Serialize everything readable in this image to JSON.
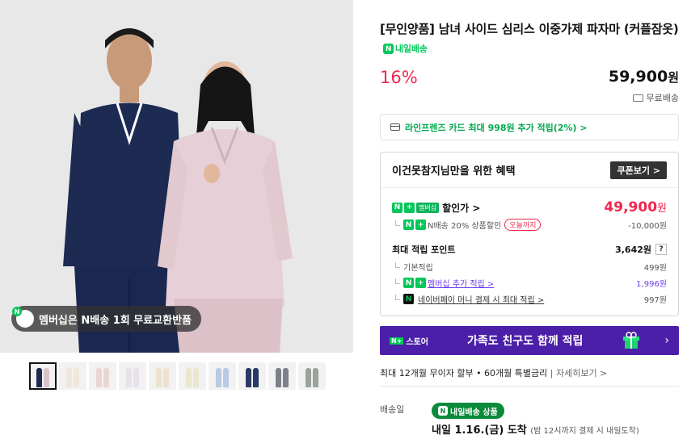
{
  "gallery": {
    "badge_text": "멤버십은 N배송 1회 무료교환반품",
    "badge_icon": "n-delivery-icon",
    "thumbnails": [
      {
        "colors": [
          "#1c2a4e",
          "#d9c4cc"
        ],
        "selected": true
      },
      {
        "colors": [
          "#efe7da",
          "#efe7da"
        ],
        "selected": false
      },
      {
        "colors": [
          "#e9d6d3",
          "#e9d6d3"
        ],
        "selected": false
      },
      {
        "colors": [
          "#e6e1ea",
          "#e6e1ea"
        ],
        "selected": false
      },
      {
        "colors": [
          "#ede3cc",
          "#ede3cc"
        ],
        "selected": false
      },
      {
        "colors": [
          "#ece5cf",
          "#ece5cf"
        ],
        "selected": false
      },
      {
        "colors": [
          "#b9c9e6",
          "#b9c9e6"
        ],
        "selected": false
      },
      {
        "colors": [
          "#2a3a66",
          "#2a3a66"
        ],
        "selected": false
      },
      {
        "colors": [
          "#7d8088",
          "#7d8088"
        ],
        "selected": false
      },
      {
        "colors": [
          "#9aa39c",
          "#9aa39c"
        ],
        "selected": false
      }
    ]
  },
  "product": {
    "title": "[무인양품] 남녀 사이드 심리스 이중가제 파자마 (커플잠옷)",
    "delivery_chip": "내일배송",
    "discount": "16%",
    "price": "59,900",
    "price_unit": "원",
    "shipping": "무료배송"
  },
  "card_promo": "라인프렌즈 카드 최대 998원 추가 적립(2%) >",
  "benefit": {
    "title": "이건못참지님만을 위한 혜택",
    "coupon_button": "쿠폰보기 >",
    "sale_label": "할인가 >",
    "membership_tag": "멤버십",
    "sale_price": "49,900",
    "sale_unit": "원",
    "n_discount_label": "N배송 20% 상품할인",
    "today_tag": "오늘까지",
    "n_discount_value": "-10,000원",
    "points_title": "최대 적립 포인트",
    "points_value": "3,642원",
    "help_icon": "?",
    "basic_label": "기본적립",
    "basic_value": "499원",
    "membership_label": "멤버십 추가 적립 >",
    "membership_value": "1,996원",
    "npay_label": "네이버페이 머니 결제 시 최대 적립 >",
    "npay_value": "997원"
  },
  "store_banner": {
    "logo": "스토어",
    "text": "가족도 친구도 함께 적립",
    "arrow": "›"
  },
  "installment": {
    "text": "최대 12개월 무이자 할부 • 60개월 특별금리",
    "link": "자세히보기 >"
  },
  "delivery": {
    "label": "배송일",
    "chip": "내일배송 상품",
    "arrival": "내일 1.16.(금) 도착",
    "note": "(밤 12시까지 결제 시 내일도착)"
  },
  "colors": {
    "accent_red": "#f0274d",
    "naver_green": "#03c75a",
    "banner_purple": "#4b1fa8",
    "link_purple": "#6a3df0"
  }
}
